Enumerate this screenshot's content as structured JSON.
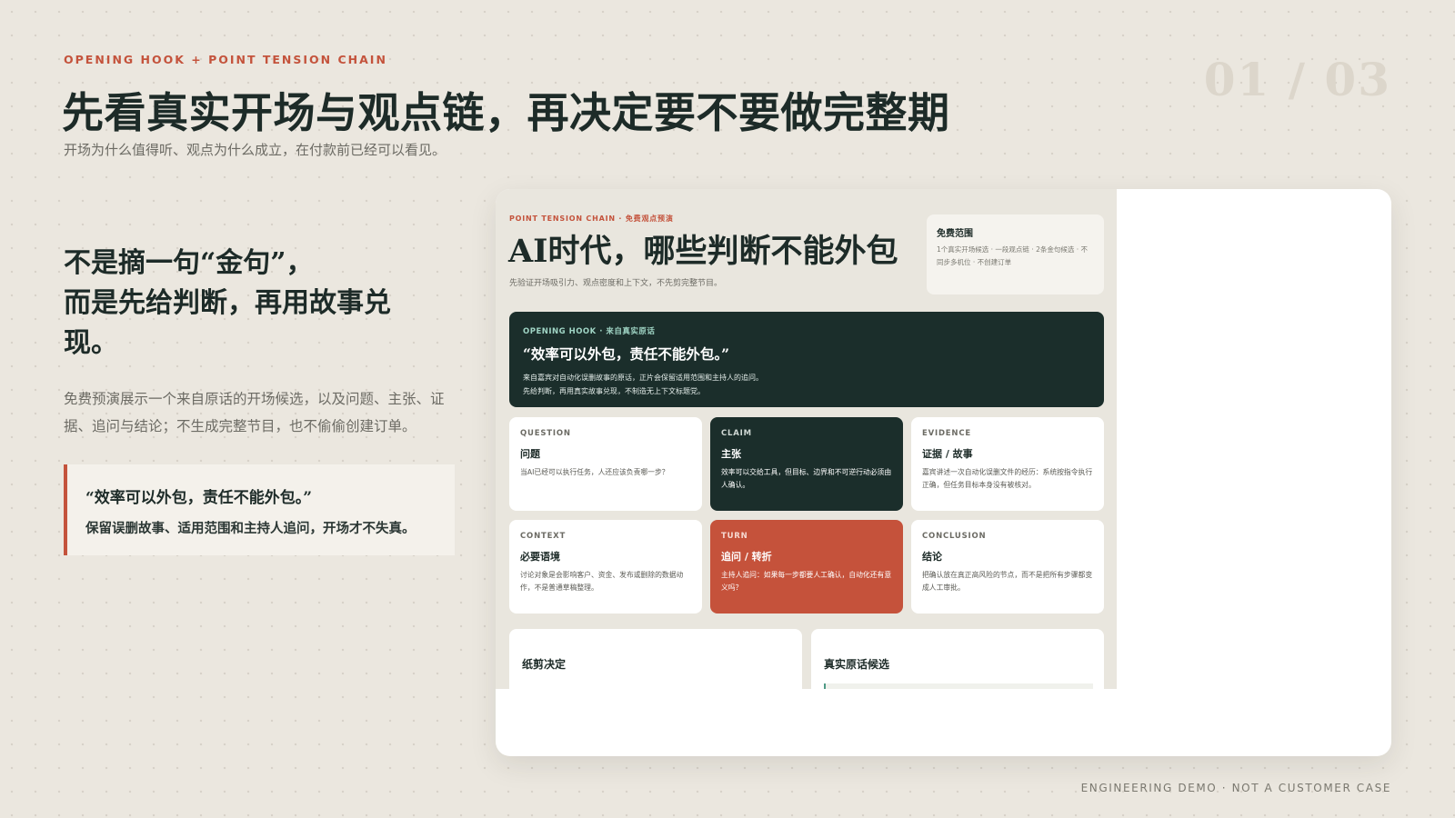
{
  "header": {
    "eyebrow": "OPENING HOOK + POINT TENSION CHAIN",
    "title": "先看真实开场与观点链，再决定要不要做完整期",
    "subtitle": "开场为什么值得听、观点为什么成立，在付款前已经可以看见。",
    "page_counter": "01 / 03"
  },
  "left": {
    "heading_line1": "不是摘一句“金句”，",
    "heading_line2": "而是先给判断，再用故事兑",
    "heading_line3": "现。",
    "body": "免费预演展示一个来自原话的开场候选，以及问题、主张、证据、追问与结论；不生成完整节目，也不偷偷创建订单。",
    "quote": "“效率可以外包，责任不能外包。”",
    "quote_sub": "保留误删故事、适用范围和主持人追问，开场才不失真。"
  },
  "preview": {
    "eyebrow": "POINT TENSION CHAIN · 免费观点预演",
    "title": "AI时代，哪些判断不能外包",
    "subtitle": "先验证开场吸引力、观点密度和上下文，不先剪完整节目。",
    "free_scope": {
      "title": "免费范围",
      "text": "1个真实开场候选 · 一段观点链 · 2条金句候选 · 不同步多机位 · 不创建订单"
    },
    "hook": {
      "eyebrow": "OPENING HOOK · 来自真实原话",
      "quote": "“效率可以外包，责任不能外包。”",
      "line1": "来自嘉宾对自动化误删故事的原话，正片会保留适用范围和主持人的追问。",
      "line2": "先给判断，再用真实故事兑现，不制造无上下文标题党。"
    },
    "cards": [
      {
        "label": "QUESTION",
        "title": "问题",
        "text": "当AI已经可以执行任务，人还应该负责哪一步？"
      },
      {
        "label": "CLAIM",
        "title": "主张",
        "text": "效率可以交给工具，但目标、边界和不可逆行动必须由人确认。"
      },
      {
        "label": "EVIDENCE",
        "title": "证据 / 故事",
        "text": "嘉宾讲述一次自动化误删文件的经历：系统按指令执行正确，但任务目标本身没有被核对。"
      },
      {
        "label": "CONTEXT",
        "title": "必要语境",
        "text": "讨论对象是会影响客户、资金、发布或删除的数据动作，不是普通草稿整理。"
      },
      {
        "label": "TURN",
        "title": "追问 / 转折",
        "text": "主持人追问：如果每一步都要人工确认，自动化还有意义吗？"
      },
      {
        "label": "CONCLUSION",
        "title": "结论",
        "text": "把确认放在真正高风险的节点，而不是把所有步骤都变成人工审批。"
      }
    ],
    "bottom_left_title": "纸剪决定",
    "bottom_right_title": "真实原话候选"
  },
  "footer": "ENGINEERING DEMO · NOT A CUSTOMER CASE",
  "colors": {
    "background": "#ebe7df",
    "accent_red": "#c4533c",
    "dark_green": "#1b2e2b",
    "text_dark": "#1d2b28",
    "text_muted": "#6c6b64"
  }
}
